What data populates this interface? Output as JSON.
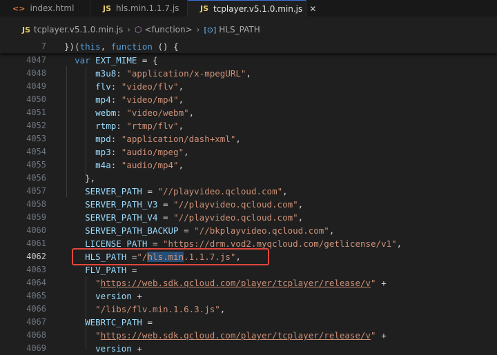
{
  "tabs": [
    {
      "icon": "<>",
      "label": "index.html"
    },
    {
      "icon": "JS",
      "label": "hls.min.1.1.7.js"
    },
    {
      "icon": "JS",
      "label": "tcplayer.v5.1.0.min.js",
      "close": "✕"
    }
  ],
  "breadcrumb": {
    "file_icon": "JS",
    "file": "tcplayer.v5.1.0.min.js",
    "sep": "›",
    "fn_icon": "⬡",
    "fn": "<function>",
    "var_icon": "[⊙]",
    "var": "HLS_PATH"
  },
  "lines": [
    {
      "num": "7",
      "parts": [
        [
          "pn",
          "})("
        ],
        [
          "kw",
          "this"
        ],
        [
          "pn",
          ", "
        ],
        [
          "kw",
          "function"
        ],
        [
          "pn",
          " () {"
        ]
      ]
    },
    {
      "num": "4047",
      "parts": [
        [
          "pn",
          "  "
        ],
        [
          "kw",
          "var"
        ],
        [
          "pn",
          " "
        ],
        [
          "vr",
          "EXT_MIME"
        ],
        [
          "pn",
          " = {"
        ]
      ]
    },
    {
      "num": "4048",
      "parts": [
        [
          "pn",
          "      "
        ],
        [
          "pr",
          "m3u8"
        ],
        [
          "pn",
          ": "
        ],
        [
          "st",
          "\"application/x-mpegURL\""
        ],
        [
          "pn",
          ","
        ]
      ]
    },
    {
      "num": "4049",
      "parts": [
        [
          "pn",
          "      "
        ],
        [
          "pr",
          "flv"
        ],
        [
          "pn",
          ": "
        ],
        [
          "st",
          "\"video/flv\""
        ],
        [
          "pn",
          ","
        ]
      ]
    },
    {
      "num": "4050",
      "parts": [
        [
          "pn",
          "      "
        ],
        [
          "pr",
          "mp4"
        ],
        [
          "pn",
          ": "
        ],
        [
          "st",
          "\"video/mp4\""
        ],
        [
          "pn",
          ","
        ]
      ]
    },
    {
      "num": "4051",
      "parts": [
        [
          "pn",
          "      "
        ],
        [
          "pr",
          "webm"
        ],
        [
          "pn",
          ": "
        ],
        [
          "st",
          "\"video/webm\""
        ],
        [
          "pn",
          ","
        ]
      ]
    },
    {
      "num": "4052",
      "parts": [
        [
          "pn",
          "      "
        ],
        [
          "pr",
          "rtmp"
        ],
        [
          "pn",
          ": "
        ],
        [
          "st",
          "\"rtmp/flv\""
        ],
        [
          "pn",
          ","
        ]
      ]
    },
    {
      "num": "4053",
      "parts": [
        [
          "pn",
          "      "
        ],
        [
          "pr",
          "mpd"
        ],
        [
          "pn",
          ": "
        ],
        [
          "st",
          "\"application/dash+xml\""
        ],
        [
          "pn",
          ","
        ]
      ]
    },
    {
      "num": "4054",
      "parts": [
        [
          "pn",
          "      "
        ],
        [
          "pr",
          "mp3"
        ],
        [
          "pn",
          ": "
        ],
        [
          "st",
          "\"audio/mpeg\""
        ],
        [
          "pn",
          ","
        ]
      ]
    },
    {
      "num": "4055",
      "parts": [
        [
          "pn",
          "      "
        ],
        [
          "pr",
          "m4a"
        ],
        [
          "pn",
          ": "
        ],
        [
          "st",
          "\"audio/mp4\""
        ],
        [
          "pn",
          ","
        ]
      ]
    },
    {
      "num": "4056",
      "parts": [
        [
          "pn",
          "    },"
        ]
      ]
    },
    {
      "num": "4057",
      "parts": [
        [
          "pn",
          "    "
        ],
        [
          "vr",
          "SERVER_PATH"
        ],
        [
          "pn",
          " = "
        ],
        [
          "st",
          "\"//playvideo.qcloud.com\""
        ],
        [
          "pn",
          ","
        ]
      ]
    },
    {
      "num": "4058",
      "parts": [
        [
          "pn",
          "    "
        ],
        [
          "vr",
          "SERVER_PATH_V3"
        ],
        [
          "pn",
          " = "
        ],
        [
          "st",
          "\"//playvideo.qcloud.com\""
        ],
        [
          "pn",
          ","
        ]
      ]
    },
    {
      "num": "4059",
      "parts": [
        [
          "pn",
          "    "
        ],
        [
          "vr",
          "SERVER_PATH_V4"
        ],
        [
          "pn",
          " = "
        ],
        [
          "st",
          "\"//playvideo.qcloud.com\""
        ],
        [
          "pn",
          ","
        ]
      ]
    },
    {
      "num": "4060",
      "parts": [
        [
          "pn",
          "    "
        ],
        [
          "vr",
          "SERVER_PATH_BACKUP"
        ],
        [
          "pn",
          " = "
        ],
        [
          "st",
          "\"//bkplayvideo.qcloud.com\""
        ],
        [
          "pn",
          ","
        ]
      ]
    },
    {
      "num": "4061",
      "parts": [
        [
          "pn",
          "    "
        ],
        [
          "vr",
          "LICENSE_PATH"
        ],
        [
          "pn",
          " = "
        ],
        [
          "st",
          "\"https://drm.vod2.myqcloud.com/getlicense/v1\""
        ],
        [
          "pn",
          ","
        ]
      ]
    },
    {
      "num": "4062",
      "current": true,
      "parts": [
        [
          "pn",
          "    "
        ],
        [
          "vr",
          "HLS_PATH"
        ],
        [
          "pn",
          " ="
        ],
        [
          "st",
          "\"/"
        ],
        [
          "stsel",
          "hls.min"
        ],
        [
          "st",
          ".1.1.7.js\""
        ],
        [
          "pn",
          ","
        ]
      ]
    },
    {
      "num": "4063",
      "parts": [
        [
          "pn",
          "    "
        ],
        [
          "vr",
          "FLV_PATH"
        ],
        [
          "pn",
          " ="
        ]
      ]
    },
    {
      "num": "4064",
      "parts": [
        [
          "pn",
          "      "
        ],
        [
          "st",
          "\""
        ],
        [
          "sturl",
          "https://web.sdk.qcloud.com/player/tcplayer/release/v"
        ],
        [
          "st",
          "\""
        ],
        [
          "pn",
          " +"
        ]
      ]
    },
    {
      "num": "4065",
      "parts": [
        [
          "pn",
          "      "
        ],
        [
          "vr",
          "version"
        ],
        [
          "pn",
          " +"
        ]
      ]
    },
    {
      "num": "4066",
      "parts": [
        [
          "pn",
          "      "
        ],
        [
          "st",
          "\"/libs/flv.min.1.6.3.js\""
        ],
        [
          "pn",
          ","
        ]
      ]
    },
    {
      "num": "4067",
      "parts": [
        [
          "pn",
          "    "
        ],
        [
          "vr",
          "WEBRTC_PATH"
        ],
        [
          "pn",
          " ="
        ]
      ]
    },
    {
      "num": "4068",
      "parts": [
        [
          "pn",
          "      "
        ],
        [
          "st",
          "\""
        ],
        [
          "sturl",
          "https://web.sdk.qcloud.com/player/tcplayer/release/v"
        ],
        [
          "st",
          "\""
        ],
        [
          "pn",
          " +"
        ]
      ]
    },
    {
      "num": "4069",
      "parts": [
        [
          "pn",
          "      "
        ],
        [
          "vr",
          "version"
        ],
        [
          "pn",
          " +"
        ]
      ]
    }
  ]
}
